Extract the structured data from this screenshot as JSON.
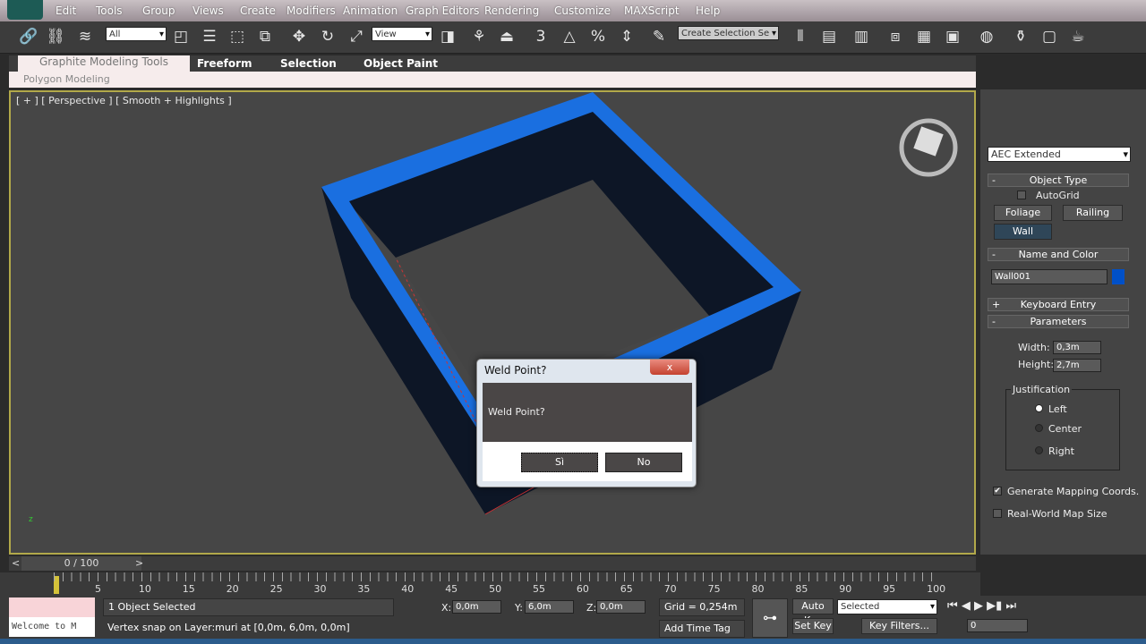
{
  "menu": [
    "Edit",
    "Tools",
    "Group",
    "Views",
    "Create",
    "Modifiers",
    "Animation",
    "Graph Editors",
    "Rendering",
    "Customize",
    "MAXScript",
    "Help"
  ],
  "toolbar": {
    "selection_filter": "All",
    "reference_coord": "View",
    "named_selection": "Create Selection Se"
  },
  "ribbon": {
    "tabs": [
      "Graphite Modeling Tools",
      "Freeform",
      "Selection",
      "Object Paint"
    ],
    "panel": "Polygon Modeling"
  },
  "viewport": {
    "label": "[ + ] [ Perspective ] [ Smooth + Highlights ]",
    "wall_color": "#0d1626",
    "top_color": "#1a6fe0",
    "bg": "#464646"
  },
  "dialog": {
    "title": "Weld Point?",
    "message": "Weld Point?",
    "yes": "Sì",
    "no": "No",
    "close": "x"
  },
  "panel": {
    "category": "AEC Extended",
    "object_type": "Object Type",
    "autogrid": "AutoGrid",
    "buttons": [
      "Foliage",
      "Railing",
      "Wall"
    ],
    "name_color": "Name and Color",
    "object_name": "Wall001",
    "object_color": "#0050c8",
    "keyboard_entry": "Keyboard Entry",
    "parameters": "Parameters",
    "width_label": "Width:",
    "width": "0,3m",
    "height_label": "Height:",
    "height": "2,7m",
    "justification": "Justification",
    "justify": [
      "Left",
      "Center",
      "Right"
    ],
    "justify_selected": "Left",
    "gen_mapping": "Generate Mapping Coords.",
    "gen_mapping_checked": true,
    "real_world": "Real-World Map Size",
    "real_world_checked": false,
    "plus": "+",
    "minus": "-"
  },
  "timeline": {
    "frame": "0 / 100",
    "prev": "<",
    "next": ">",
    "ticks": [
      "5",
      "10",
      "15",
      "20",
      "25",
      "30",
      "35",
      "40",
      "45",
      "50",
      "55",
      "60",
      "65",
      "70",
      "75",
      "80",
      "85",
      "90",
      "95",
      "100"
    ],
    "current": "0"
  },
  "status": {
    "maxscript": "Welcome to M",
    "selected": "1 Object Selected",
    "prompt": "Vertex snap on Layer:muri at [0,0m, 6,0m, 0,0m]",
    "x_label": "X:",
    "x": "0,0m",
    "y_label": "Y:",
    "y": "6,0m",
    "z_label": "Z:",
    "z": "0,0m",
    "grid": "Grid = 0,254m",
    "add_time_tag": "Add Time Tag",
    "auto_key": "Auto Key",
    "set_key": "Set Key",
    "key_mode": "Selected",
    "key_filters": "Key Filters...",
    "frame_field": "0"
  }
}
